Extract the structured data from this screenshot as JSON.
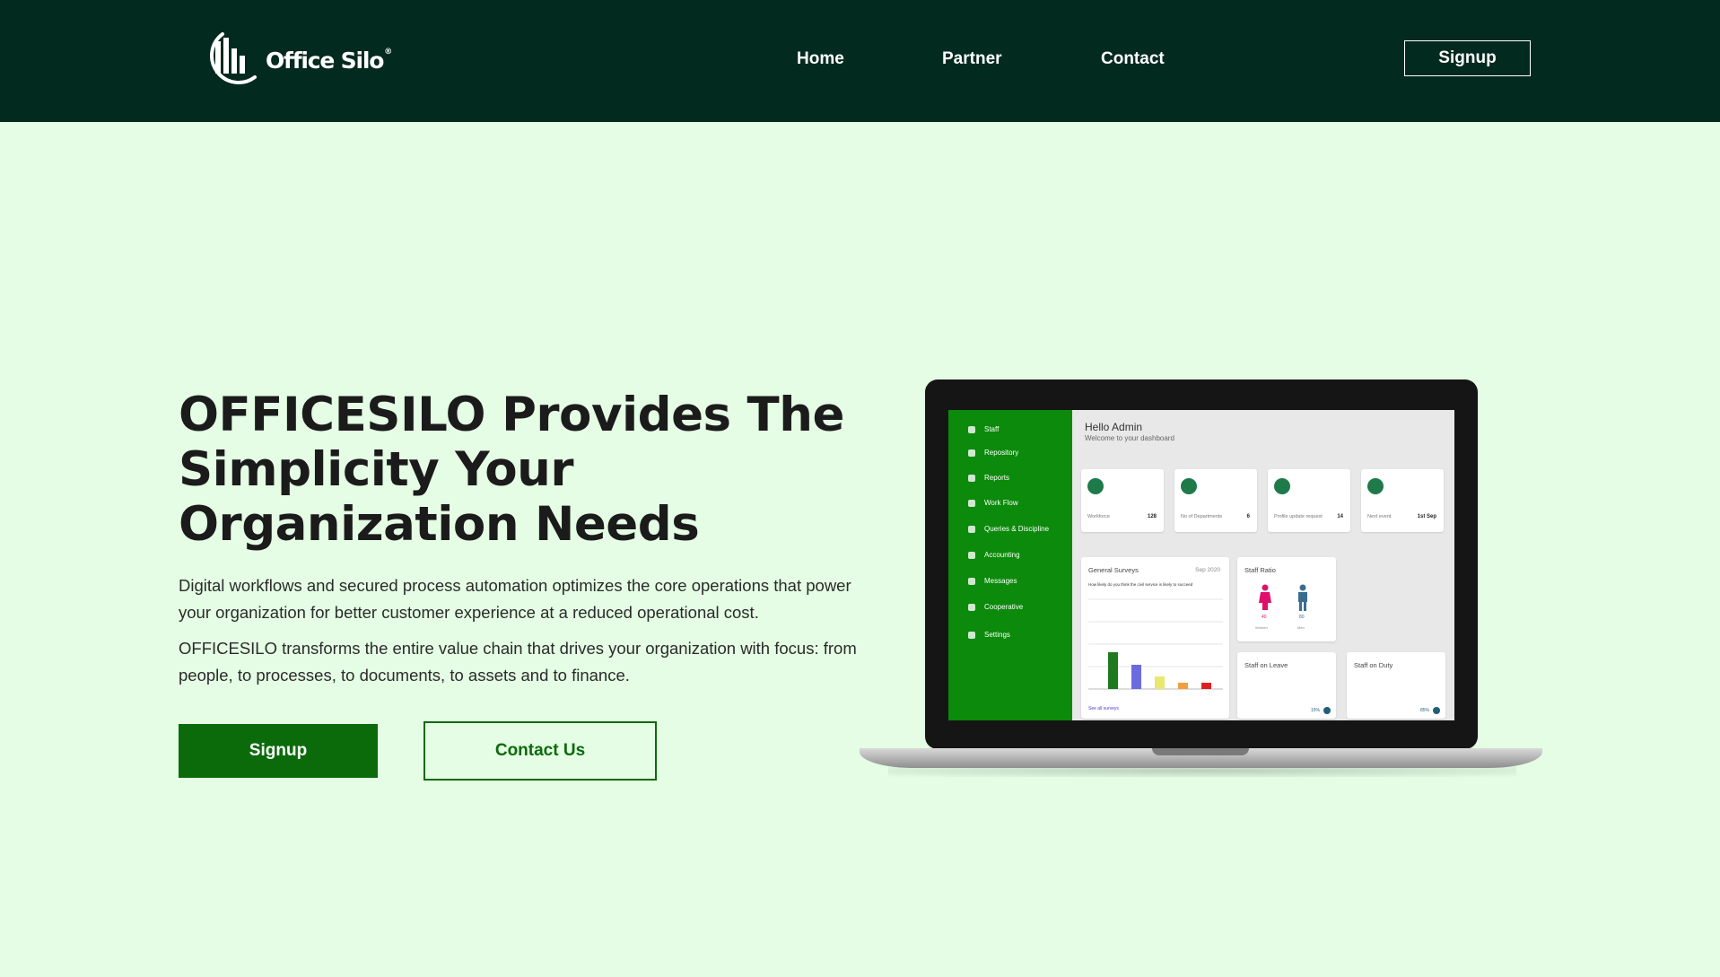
{
  "brand": {
    "name": "Office Silo",
    "reg_mark": "®"
  },
  "nav": {
    "home": "Home",
    "partner": "Partner",
    "contact": "Contact",
    "signup": "Signup"
  },
  "hero": {
    "title": "OFFICESILO Provides The Simplicity Your Organization Needs",
    "paragraph1": "Digital workflows and secured process automation optimizes the core operations that power your organization for better customer experience at a reduced operational cost.",
    "paragraph2": "OFFICESILO transforms the entire value chain that drives your organization with focus: from people, to processes, to documents, to assets and to finance.",
    "signup_button": "Signup",
    "contact_button": "Contact Us"
  },
  "dashboard": {
    "greeting": "Hello Admin",
    "welcome": "Welcome to your dashboard",
    "sidebar": [
      "Staff",
      "Repository",
      "Reports",
      "Work Flow",
      "Queries & Discipline",
      "Accounting",
      "Messages",
      "Cooperative",
      "Settings"
    ],
    "cards": [
      {
        "label": "Workforce",
        "value": "128"
      },
      {
        "label": "No of Departments",
        "value": "6"
      },
      {
        "label": "Profile update request",
        "value": "14"
      },
      {
        "label": "Next event",
        "value": "1st Sep"
      }
    ],
    "surveys": {
      "title": "General Surveys",
      "date": "Sep 2020",
      "question": "How likely do you think the civil service is likely to succeed",
      "footer": "See all surveys"
    },
    "staff_ratio": {
      "title": "Staff Ratio",
      "women": "40",
      "men": "80",
      "women_label": "Women",
      "men_label": "Men"
    },
    "staff_on_leave": {
      "title": "Staff on Leave",
      "percent": "15%"
    },
    "staff_on_duty": {
      "title": "Staff on Duty",
      "percent": "85%"
    }
  },
  "colors": {
    "header_bg": "#032a1e",
    "page_bg": "#e4fde4",
    "brand_green": "#0b6b0b",
    "sidebar_green": "#0b8a0b"
  }
}
